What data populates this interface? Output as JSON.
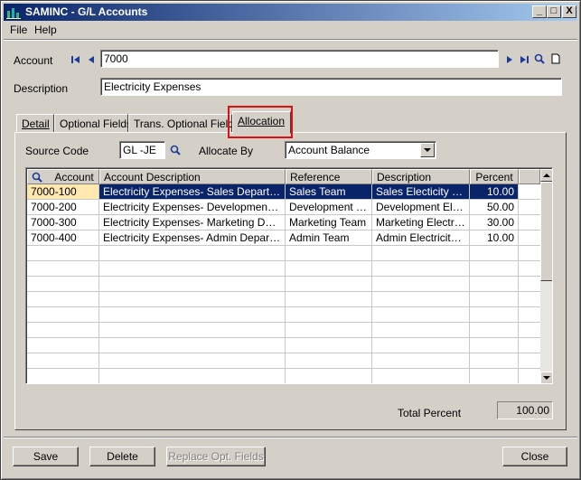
{
  "window": {
    "title": "SAMINC - G/L Accounts",
    "min": "_",
    "max": "□",
    "close": "X"
  },
  "menu": [
    "File",
    "Help"
  ],
  "account": {
    "label": "Account",
    "value": "7000"
  },
  "description": {
    "label": "Description",
    "value": "Electricity Expenses"
  },
  "tabs": [
    {
      "label": "Detail"
    },
    {
      "label": "Optional Fields"
    },
    {
      "label": "Trans. Optional Fields"
    },
    {
      "label": "Allocation"
    }
  ],
  "allocation": {
    "source_code_label": "Source Code",
    "source_code_value": "GL -JE",
    "allocate_by_label": "Allocate By",
    "allocate_by_value": "Account Balance"
  },
  "grid": {
    "headers": [
      "Account",
      "Account Description",
      "Reference",
      "Description",
      "Percent"
    ],
    "rows": [
      [
        "7000-100",
        "Electricity Expenses- Sales Department",
        "Sales Team",
        "Sales Electicity ex...",
        "10.00"
      ],
      [
        "7000-200",
        "Electricity Expenses- Development De...",
        "Development T...",
        "Development Elec...",
        "50.00"
      ],
      [
        "7000-300",
        "Electricity Expenses- Marketing Depart...",
        "Marketing Team",
        "Marketing Electrici...",
        "30.00"
      ],
      [
        "7000-400",
        "Electricity Expenses- Admin Department",
        "Admin Team",
        "Admin Electricity E...",
        "10.00"
      ]
    ]
  },
  "total": {
    "label": "Total Percent",
    "value": "100.00"
  },
  "buttons": {
    "save": "Save",
    "delete": "Delete",
    "replace": "Replace Opt. Fields",
    "close": "Close"
  },
  "colors": {
    "selection": "#0a246a",
    "highlight_box": "#e01010",
    "titlebar": "#0a246a"
  }
}
